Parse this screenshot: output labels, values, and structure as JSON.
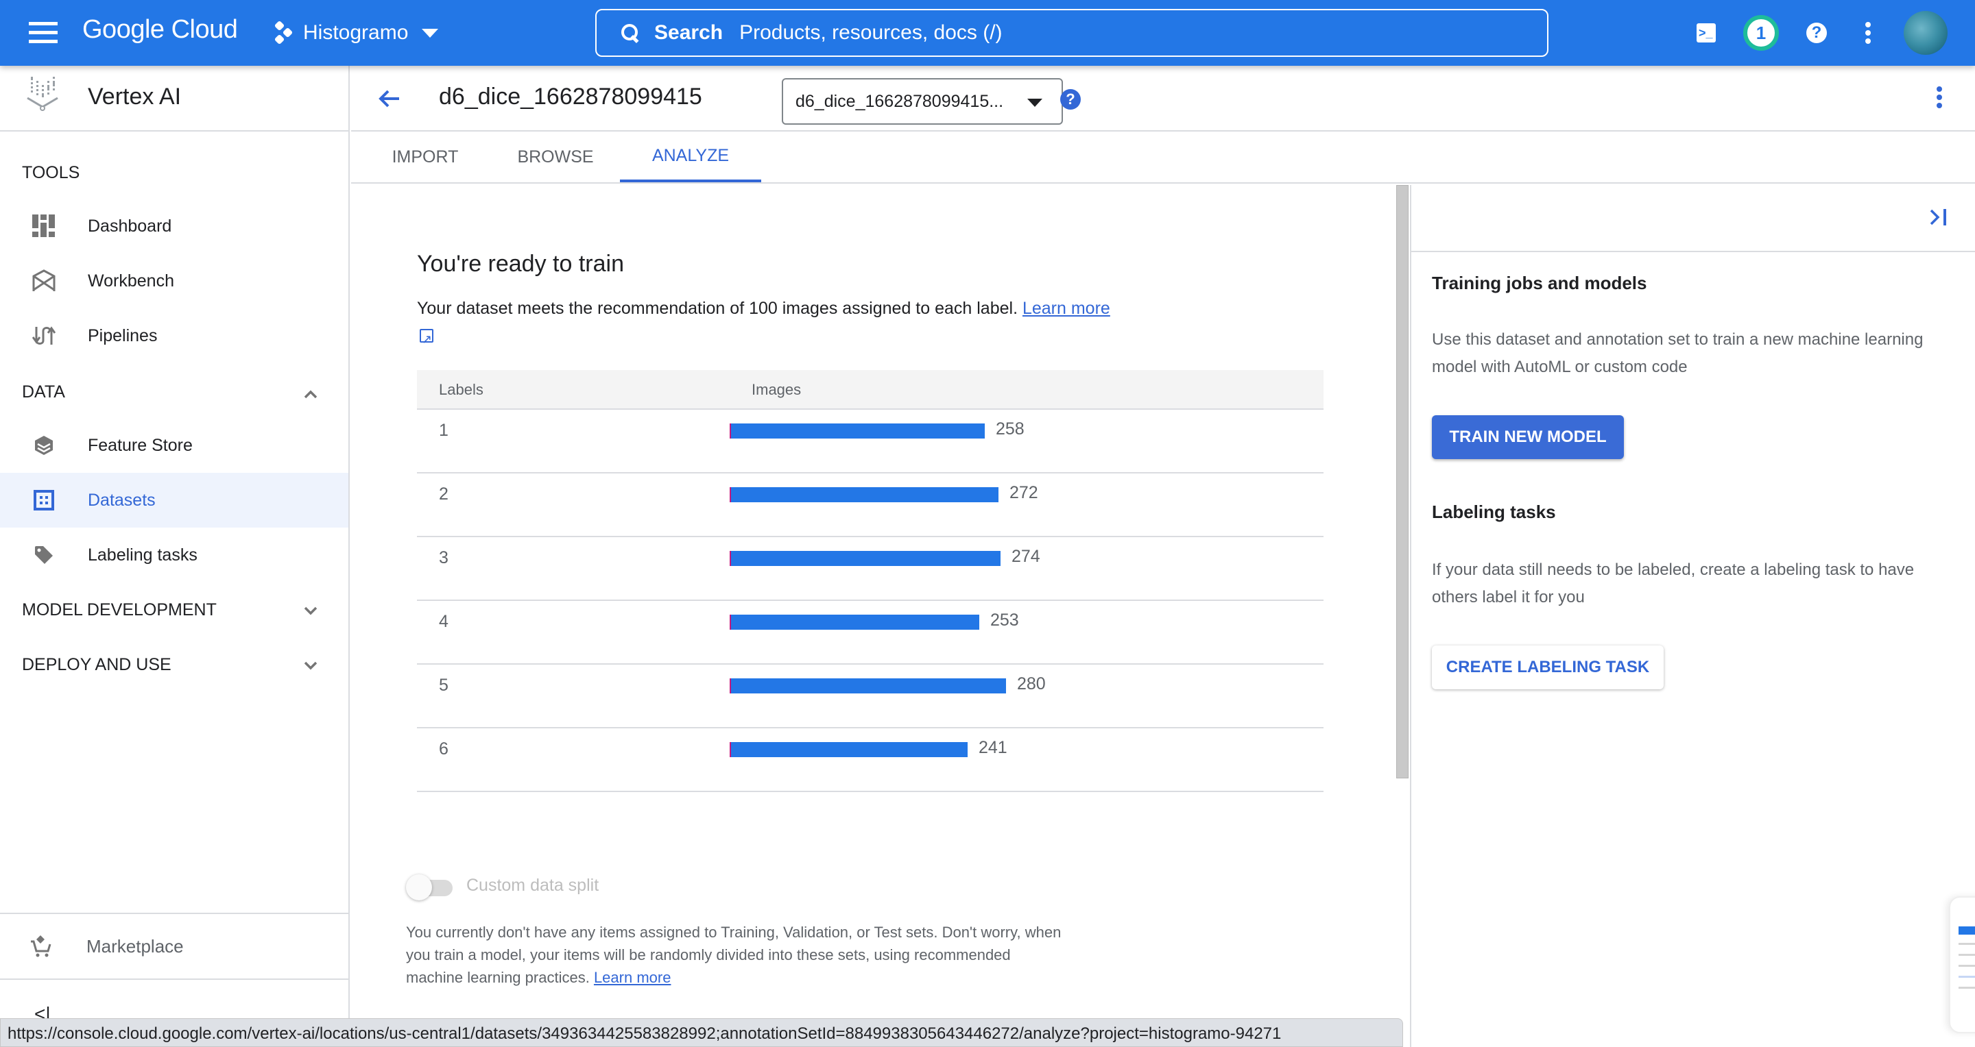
{
  "topbar": {
    "brand": "Google Cloud",
    "project": "Histogramo",
    "search_label": "Search",
    "search_placeholder": "Products, resources, docs (/)",
    "notification_count": "1",
    "help_glyph": "?",
    "shell_glyph": ">_",
    "icons": [
      "menu-icon",
      "project-icon",
      "search-icon",
      "cloud-shell-icon",
      "notification-badge",
      "help-icon",
      "more-vert-icon",
      "avatar"
    ]
  },
  "sidebar": {
    "product": "Vertex AI",
    "sections": [
      {
        "label": "TOOLS",
        "expanded": true,
        "items": [
          {
            "label": "Dashboard",
            "icon": "dashboard-icon"
          },
          {
            "label": "Workbench",
            "icon": "workbench-icon"
          },
          {
            "label": "Pipelines",
            "icon": "pipelines-icon"
          }
        ]
      },
      {
        "label": "DATA",
        "expanded": true,
        "items": [
          {
            "label": "Feature Store",
            "icon": "feature-store-icon"
          },
          {
            "label": "Datasets",
            "icon": "datasets-icon",
            "active": true
          },
          {
            "label": "Labeling tasks",
            "icon": "label-tag-icon"
          }
        ]
      },
      {
        "label": "MODEL DEVELOPMENT",
        "expanded": false,
        "items": []
      },
      {
        "label": "DEPLOY AND USE",
        "expanded": false,
        "items": []
      }
    ],
    "marketplace": "Marketplace",
    "collapse_glyph": "<|"
  },
  "page": {
    "title": "d6_dice_1662878099415",
    "annotation_set_select": "d6_dice_1662878099415...",
    "help_glyph": "?"
  },
  "tabs": [
    {
      "label": "IMPORT",
      "active": false
    },
    {
      "label": "BROWSE",
      "active": false
    },
    {
      "label": "ANALYZE",
      "active": true
    }
  ],
  "analyze": {
    "heading": "You're ready to train",
    "message": "Your dataset meets the recommendation of 100 images assigned to each label.",
    "learn_more": "Learn more",
    "table": {
      "columns": [
        "Labels",
        "Images"
      ],
      "rows": [
        {
          "label": "1",
          "images": 258
        },
        {
          "label": "2",
          "images": 272
        },
        {
          "label": "3",
          "images": 274
        },
        {
          "label": "4",
          "images": 253
        },
        {
          "label": "5",
          "images": 280
        },
        {
          "label": "6",
          "images": 241
        }
      ]
    },
    "custom_split": {
      "label": "Custom data split",
      "enabled": false,
      "disabled": true
    },
    "split_message": "You currently don't have any items assigned to Training, Validation, or Test sets. Don't worry, when you train a model, your items will be randomly divided into these sets, using recommended machine learning practices.",
    "split_learn_more": "Learn more"
  },
  "right_panel": {
    "training": {
      "heading": "Training jobs and models",
      "text": "Use this dataset and annotation set to train a new machine learning model with AutoML or custom code",
      "button": "TRAIN NEW MODEL"
    },
    "labeling": {
      "heading": "Labeling tasks",
      "text": "If your data still needs to be labeled, create a labeling task to have others label it for you",
      "button": "CREATE LABELING TASK"
    }
  },
  "status_bar": {
    "url": "https://console.cloud.google.com/vertex-ai/locations/us-central1/datasets/3493634425583828992;annotationSetId=8849938305643446272/analyze?project=histogramo-94271"
  },
  "colors": {
    "topbar": "#2377e6",
    "accent": "#3367d6",
    "bar": "#2377e6",
    "notification_ring": "#1ebc9a",
    "active_item_bg": "#eef3fd"
  },
  "chart_data": {
    "type": "bar",
    "orientation": "horizontal",
    "title": "",
    "xlabel": "Images",
    "ylabel": "Labels",
    "categories": [
      "1",
      "2",
      "3",
      "4",
      "5",
      "6"
    ],
    "values": [
      258,
      272,
      274,
      253,
      280,
      241
    ]
  }
}
